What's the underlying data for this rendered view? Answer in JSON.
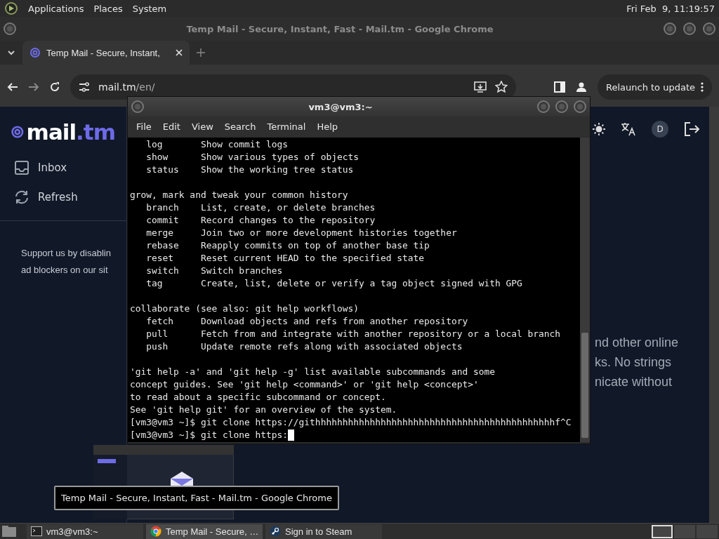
{
  "top_panel": {
    "menus": [
      "Applications",
      "Places",
      "System"
    ],
    "clock": "Fri Feb  9, 11:19:57"
  },
  "browser": {
    "title": "Temp Mail - Secure, Instant, Fast - Mail.tm - Google Chrome",
    "tabs": [
      {
        "label": "Temp Mail - Secure, Instant,",
        "selected": true
      }
    ],
    "url_host": "mail.tm",
    "url_path": "/en/",
    "relaunch_button": "Relaunch to update",
    "page": {
      "logo": {
        "name": "mail",
        "suffix": ".tm"
      },
      "nav": [
        {
          "label": "Inbox",
          "kind": "inbox"
        },
        {
          "label": "Refresh",
          "kind": "refresh"
        }
      ],
      "support_text": [
        "Support us by disablin",
        "ad blockers on our sit"
      ],
      "avatar_initial": "D",
      "body_fragments": [
        "nd other online",
        "ks. No strings",
        "nicate without"
      ]
    }
  },
  "terminal": {
    "title": "vm3@vm3:~",
    "menus": [
      "File",
      "Edit",
      "View",
      "Search",
      "Terminal",
      "Help"
    ],
    "blocks": [
      [
        "   log       Show commit logs",
        "   show      Show various types of objects",
        "   status    Show the working tree status"
      ],
      [
        "grow, mark and tweak your common history",
        "   branch    List, create, or delete branches",
        "   commit    Record changes to the repository",
        "   merge     Join two or more development histories together",
        "   rebase    Reapply commits on top of another base tip",
        "   reset     Reset current HEAD to the specified state",
        "   switch    Switch branches",
        "   tag       Create, list, delete or verify a tag object signed with GPG"
      ],
      [
        "collaborate (see also: git help workflows)",
        "   fetch     Download objects and refs from another repository",
        "   pull      Fetch from and integrate with another repository or a local branch",
        "   push      Update remote refs along with associated objects"
      ],
      [
        "'git help -a' and 'git help -g' list available subcommands and some",
        "concept guides. See 'git help <command>' or 'git help <concept>'",
        "to read about a specific subcommand or concept.",
        "See 'git help git' for an overview of the system.",
        "[vm3@vm3 ~]$ git clone https://githhhhhhhhhhhhhhhhhhhhhhhhhhhhhhhhhhhhhhhhhhhhf^C",
        "[vm3@vm3 ~]$ git clone https:"
      ]
    ]
  },
  "tooltip": "Temp Mail - Secure, Instant, Fast - Mail.tm - Google Chrome",
  "taskbar": {
    "tasks": [
      {
        "label": "vm3@vm3:~",
        "kind": "terminal",
        "selected": false
      },
      {
        "label": "Temp Mail - Secure, …",
        "kind": "chrome",
        "selected": true
      },
      {
        "label": "Sign in to Steam",
        "kind": "steam",
        "selected": false
      }
    ]
  }
}
